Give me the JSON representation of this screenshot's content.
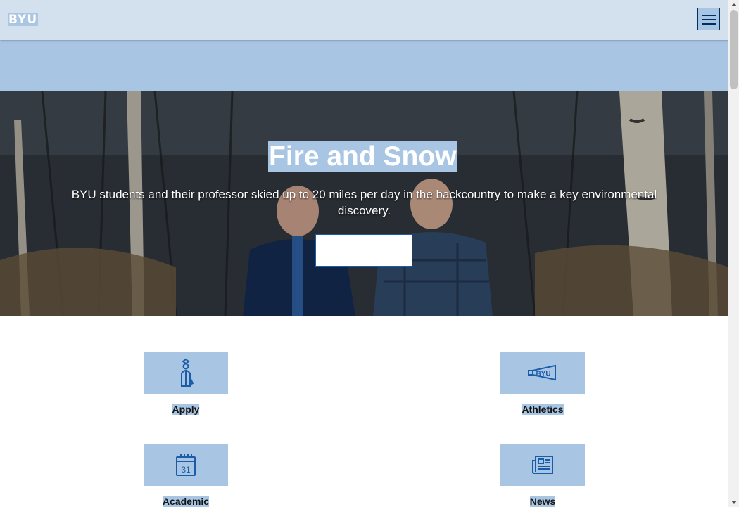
{
  "header": {
    "logo_text": "BYU",
    "menu_icon": "hamburger-icon"
  },
  "hero": {
    "title": "Fire and Snow",
    "description": "BYU students and their professor skied up to 20 miles per day in the backcountry to make a key environmental discovery.",
    "button_label": ""
  },
  "tiles": [
    {
      "label": "Apply",
      "icon": "graduate-icon"
    },
    {
      "label": "Athletics",
      "icon": "megaphone-icon"
    },
    {
      "label": "Academic",
      "icon": "calendar-icon"
    },
    {
      "label": "News",
      "icon": "newspaper-icon"
    }
  ],
  "colors": {
    "header_bg": "#d3e1ef",
    "accent": "#a8c5e3",
    "navy": "#002e5d",
    "icon_blue": "#1a5ca8"
  }
}
